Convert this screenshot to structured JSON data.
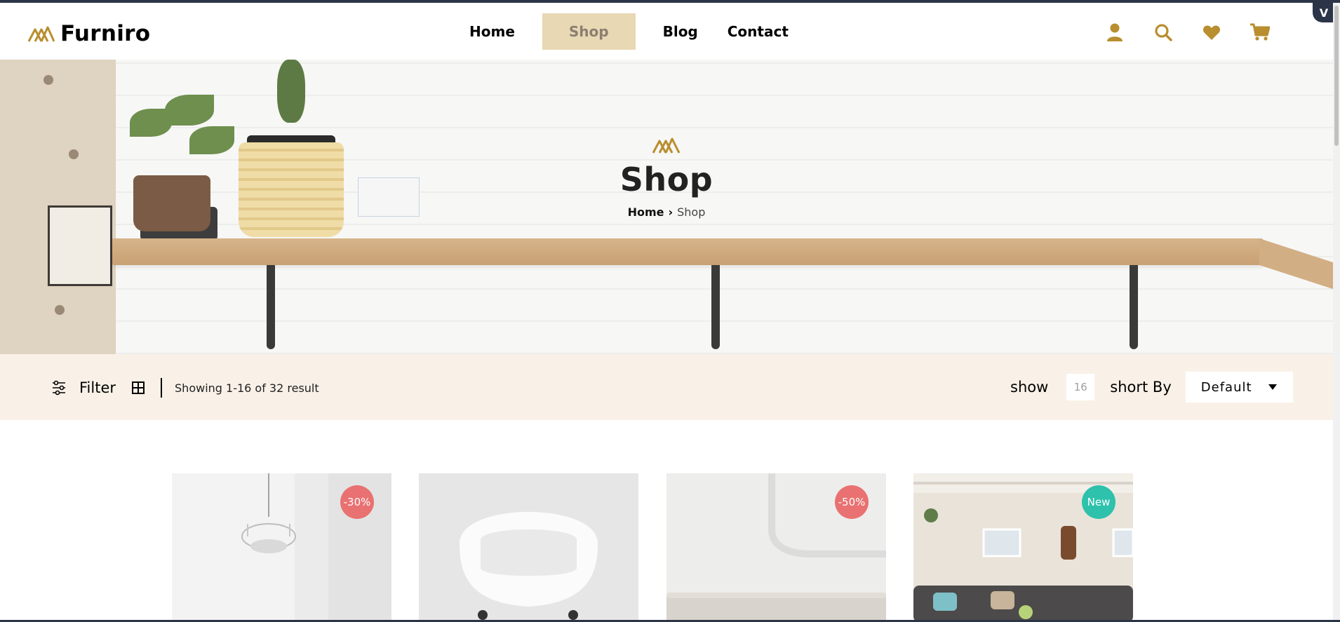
{
  "brand": {
    "name": "Furniro",
    "accent": "#b88e2f"
  },
  "nav": {
    "items": [
      {
        "label": "Home",
        "active": false
      },
      {
        "label": "Shop",
        "active": true
      },
      {
        "label": "Blog",
        "active": false
      },
      {
        "label": "Contact",
        "active": false
      }
    ]
  },
  "header_icons": [
    "user-icon",
    "search-icon",
    "heart-icon",
    "cart-icon"
  ],
  "hero": {
    "title": "Shop",
    "breadcrumb": {
      "home": "Home",
      "current": "Shop"
    }
  },
  "filterbar": {
    "filter_label": "Filter",
    "showing_text": "Showing 1-16 of 32 result",
    "show_label": "show",
    "show_value": "16",
    "sort_label": "short By",
    "sort_value": "Default"
  },
  "products": [
    {
      "badge": "-30%",
      "badge_color": "#e97171",
      "image": "chandelier"
    },
    {
      "badge": "",
      "badge_color": "",
      "image": "white-chair"
    },
    {
      "badge": "-50%",
      "badge_color": "#e97171",
      "image": "sofa"
    },
    {
      "badge": "New",
      "badge_color": "#2ec1ac",
      "image": "living-room"
    }
  ],
  "widget_badge": "V"
}
